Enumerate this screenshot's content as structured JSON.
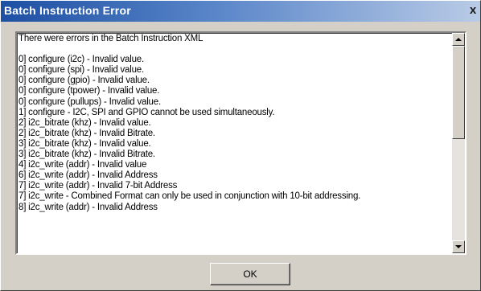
{
  "window": {
    "title": "Batch Instruction Error",
    "close_glyph": "x"
  },
  "message": {
    "lines": [
      "There were errors in the Batch Instruction XML",
      "",
      "0] configure (i2c) - Invalid value.",
      "0] configure (spi) - Invalid value.",
      "0] configure (gpio) - Invalid value.",
      "0] configure (tpower) - Invalid value.",
      "0] configure (pullups) - Invalid value.",
      "1] configure - I2C, SPI and GPIO cannot be used simultaneously.",
      "2] i2c_bitrate (khz) - Invalid value.",
      "2] i2c_bitrate (khz) - Invalid Bitrate.",
      "3] i2c_bitrate (khz) - Invalid value.",
      "3] i2c_bitrate (khz) - Invalid Bitrate.",
      "4] i2c_write (addr) - Invalid value",
      "6] i2c_write (addr) - Invalid Address",
      "7] i2c_write (addr) - Invalid 7-bit Address",
      "7] i2c_write - Combined Format can only be used in conjunction with 10-bit addressing.",
      "8] i2c_write (addr) - Invalid Address"
    ]
  },
  "buttons": {
    "ok_label": "OK"
  },
  "icons": {
    "close": "close-icon",
    "scroll_up": "arrow-up-icon",
    "scroll_down": "arrow-down-icon"
  }
}
